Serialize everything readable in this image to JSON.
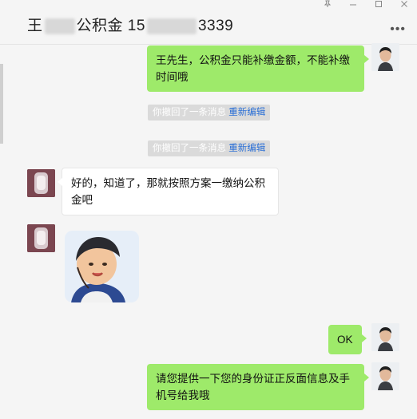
{
  "header": {
    "title_prefix": "王",
    "title_middle": "公积金 15",
    "title_suffix": "3339",
    "icons": [
      "pin-icon",
      "minimize-icon",
      "maximize-icon",
      "close-icon",
      "more-icon"
    ]
  },
  "messages": {
    "m1": "王先生，公积金只能补缴金额，不能补缴时间哦",
    "recall1": "你撤回了一条消息",
    "reedit1": "重新编辑",
    "recall2": "你撤回了一条消息",
    "reedit2": "重新编辑",
    "m2": "好的，知道了，那就按照方案一缴纳公积金吧",
    "m3": "OK",
    "m4": "请您提供一下您的身份证正反面信息及手机号给我哦"
  },
  "colors": {
    "bubble_green": "#9eea6a",
    "bubble_white": "#ffffff",
    "background": "#f5f5f5",
    "link_blue": "#2a6fd6"
  }
}
